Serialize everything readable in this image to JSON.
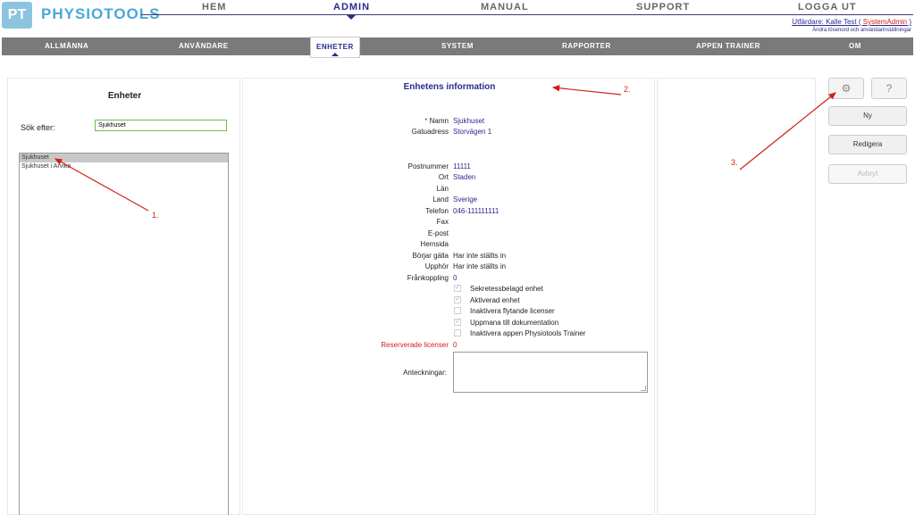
{
  "header": {
    "logo_letters": "PT",
    "logo_text": "PHYSIOTOOLS",
    "nav": [
      "HEM",
      "ADMIN",
      "MANUAL",
      "SUPPORT",
      "LOGGA UT"
    ],
    "issuer_prefix": "Utfärdare: Kalle Test ( ",
    "issuer_role": "SystemAdmin",
    "issuer_suffix": " )",
    "issuer_sub": "Ändra lösenord och användarinställningar"
  },
  "tabs": [
    "ALLMÄNNA",
    "ANVÄNDARE",
    "ENHETER",
    "SYSTEM",
    "RAPPORTER",
    "APPEN TRAINER",
    "OM"
  ],
  "left": {
    "title": "Enheter",
    "search_label": "Sök efter:",
    "search_value": "Sjukhuset",
    "units": [
      "Sjukhuset",
      "Sjukhuset i Arvika"
    ]
  },
  "detail": {
    "title": "Enhetens information",
    "required_mark": "*",
    "fields": [
      {
        "label": "Namn",
        "value": "Sjukhuset"
      },
      {
        "label": "Gatuadress",
        "value": "Storvägen 1"
      },
      {
        "label": "Postnummer",
        "value": "11111"
      },
      {
        "label": "Ort",
        "value": "Staden"
      },
      {
        "label": "Län",
        "value": ""
      },
      {
        "label": "Land",
        "value": "Sverige"
      },
      {
        "label": "Telefon",
        "value": "046-111111111"
      },
      {
        "label": "Fax",
        "value": ""
      },
      {
        "label": "E-post",
        "value": ""
      },
      {
        "label": "Hemsida",
        "value": ""
      },
      {
        "label": "Börjar gälla",
        "value": "Har inte ställts in"
      },
      {
        "label": "Upphör",
        "value": "Har inte ställts in"
      },
      {
        "label": "Frånkoppling",
        "value": "0"
      }
    ],
    "checkboxes": [
      {
        "label": "Sekretessbelagd enhet",
        "checked": true
      },
      {
        "label": "Aktiverad enhet",
        "checked": true
      },
      {
        "label": "Inaktivera flytande licenser",
        "checked": false
      },
      {
        "label": "Uppmana till dokumentation",
        "checked": true
      },
      {
        "label": "Inaktivera appen Physiotools Trainer",
        "checked": false
      }
    ],
    "reserved_label": "Reserverade licenser",
    "reserved_value": "0",
    "notes_label": "Anteckningar:",
    "check_glyph": "✓"
  },
  "actions": {
    "gear_icon": "⚙",
    "help_icon": "?",
    "new": "Ny",
    "edit": "Redigera",
    "cancel": "Avbryt"
  },
  "annotations": [
    "1.",
    "2.",
    "3."
  ],
  "colors": {
    "accent": "#2a2a90",
    "red": "#d0201b",
    "tabbar": "#7a7a7a",
    "logo": "#4aa8d8"
  }
}
